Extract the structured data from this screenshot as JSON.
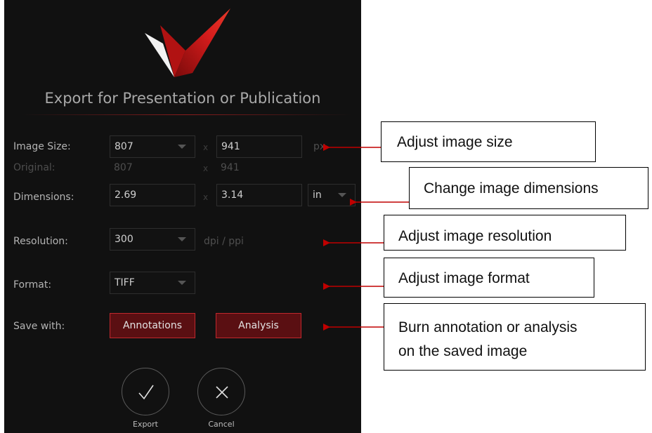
{
  "dialog": {
    "title": "Export for Presentation or Publication",
    "image_size": {
      "label": "Image Size:",
      "width": "807",
      "times": "x",
      "height": "941",
      "unit": "px"
    },
    "original": {
      "label": "Original:",
      "width": "807",
      "times": "x",
      "height": "941"
    },
    "dimensions": {
      "label": "Dimensions:",
      "width": "2.69",
      "times": "x",
      "height": "3.14",
      "unit": "in"
    },
    "resolution": {
      "label": "Resolution:",
      "value": "300",
      "unit": "dpi / ppi"
    },
    "format": {
      "label": "Format:",
      "value": "TIFF"
    },
    "save_with": {
      "label": "Save with:",
      "annotations": "Annotations",
      "analysis": "Analysis"
    },
    "export_label": "Export",
    "cancel_label": "Cancel"
  },
  "callouts": {
    "size": "Adjust image size",
    "dimensions": "Change image dimensions",
    "resolution": "Adjust image resolution",
    "format": "Adjust image format",
    "burn_line1": "Burn annotation or analysis",
    "burn_line2": "on the saved image"
  },
  "colors": {
    "accent": "#c0282d",
    "background": "#111111",
    "arrow": "#c00000"
  }
}
